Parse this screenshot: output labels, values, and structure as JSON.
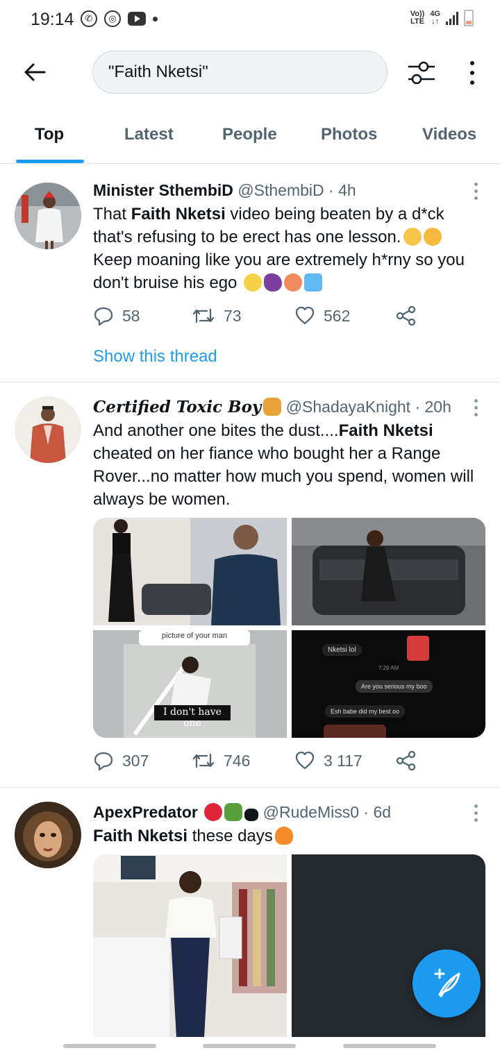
{
  "status_bar": {
    "time": "19:14",
    "network": "4G",
    "volte_top": "Vo))",
    "volte_bottom": "LTE",
    "icons": [
      "whatsapp-icon",
      "sync-icon",
      "youtube-icon",
      "dot-icon",
      "signal-icon",
      "battery-icon"
    ]
  },
  "header": {
    "search_value": "\"Faith Nketsi\""
  },
  "tabs": [
    {
      "label": "Top",
      "active": true
    },
    {
      "label": "Latest",
      "active": false
    },
    {
      "label": "People",
      "active": false
    },
    {
      "label": "Photos",
      "active": false
    },
    {
      "label": "Videos",
      "active": false
    }
  ],
  "tweets": [
    {
      "name": "Minister SthembiD",
      "handle": "@SthembiD",
      "time": "4h",
      "text_pre": "That ",
      "text_bold": "Faith Nketsi",
      "text_post": " video being beaten by a d*ck that's refusing to be erect has one lesson.",
      "text_line2": "Keep moaning like you are extremely h*rny so you don't bruise his ego",
      "replies": "58",
      "retweets": "73",
      "likes": "562",
      "show_thread": "Show this thread"
    },
    {
      "name": "Certified Toxic Boy",
      "handle": "@ShadayaKnight",
      "time": "20h",
      "text_pre": "And another one bites the dust....",
      "text_bold": "Faith Nketsi",
      "text_post": " cheated on her fiance who bought her a Range Rover...no matter how much you spend, women will always be women.",
      "media_captions": {
        "pic3_top": "picture of your man",
        "pic3_sub": "I don't have one",
        "chat_1": "Nketsi lol",
        "chat_time": "7:29 AM",
        "chat_2": "Are you serious my boo",
        "chat_3": "Esh babe did my best oo"
      },
      "replies": "307",
      "retweets": "746",
      "likes": "3 117"
    },
    {
      "name": "ApexPredator",
      "handle": "@RudeMiss0",
      "time": "6d",
      "text_bold": "Faith Nketsi",
      "text_post": " these days",
      "replies": "",
      "retweets": "",
      "likes": ""
    }
  ],
  "separator": "·",
  "colors": {
    "accent": "#1d9bf0",
    "text": "#0f1419",
    "muted": "#536471",
    "border": "#dfe4e7"
  }
}
